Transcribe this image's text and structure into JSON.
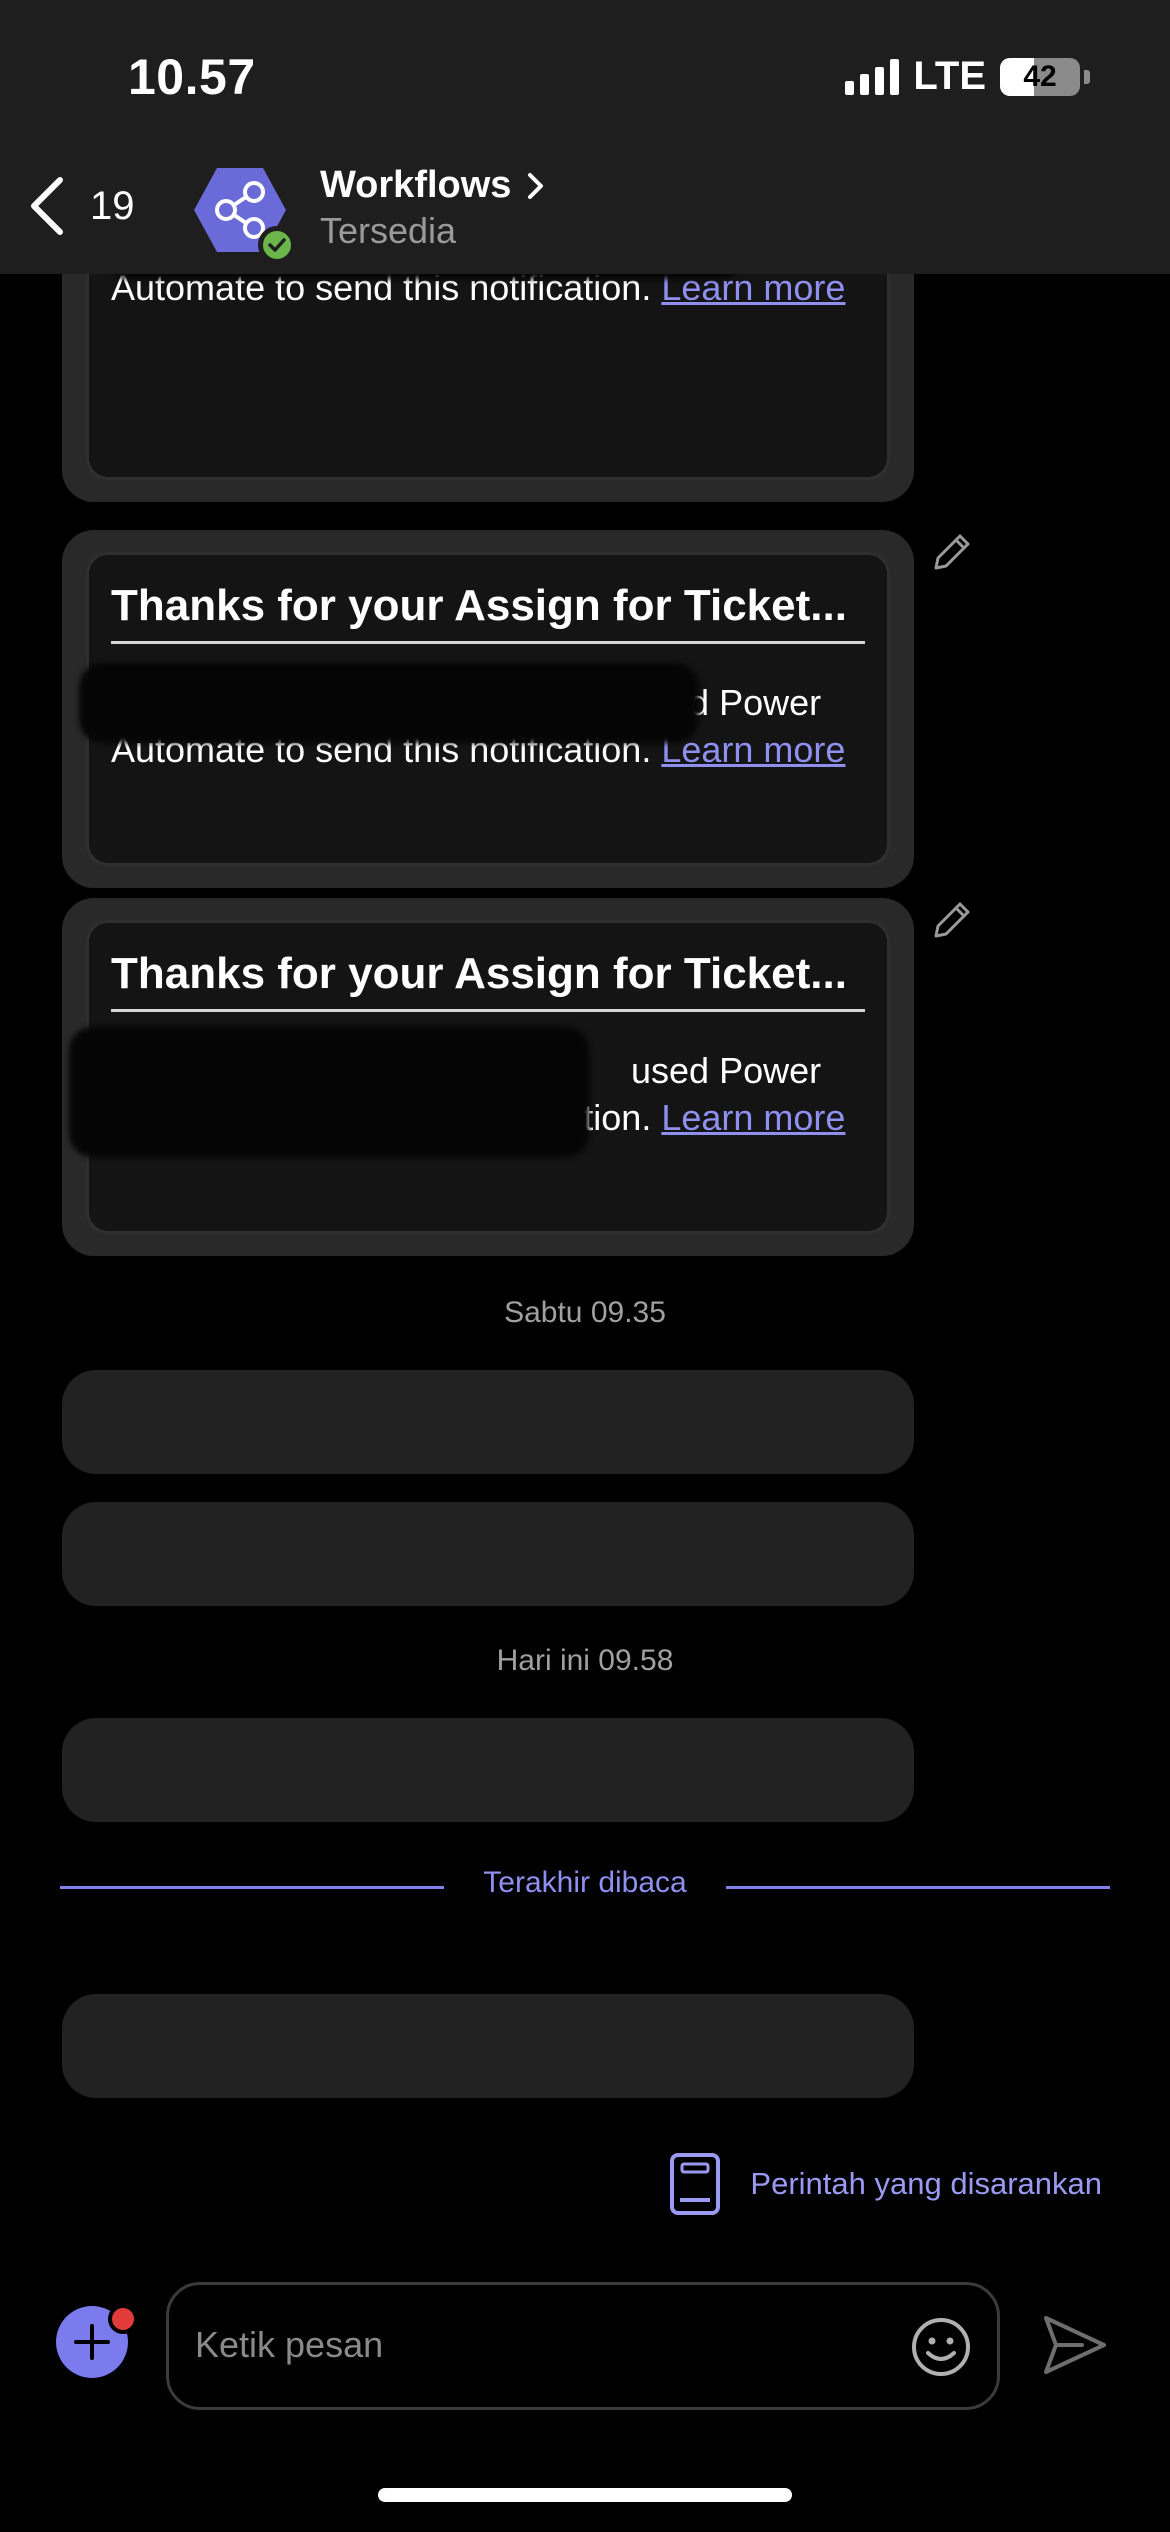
{
  "status": {
    "time": "10.57",
    "network": "LTE",
    "battery_percent": "42",
    "battery_level": 0.42
  },
  "header": {
    "back_count": "19",
    "title": "Workflows",
    "subtitle": "Tersedia",
    "accent": "#6a6ad8",
    "online_color": "#6bb54a"
  },
  "messages": [
    {
      "type": "card",
      "title": "",
      "body_text": "used Power Automate to send this notification.",
      "link_label": "Learn more"
    },
    {
      "type": "card",
      "title": "Thanks for your Assign for Ticket...",
      "body_text": "used Power Automate to send this notification.",
      "link_label": "Learn more"
    },
    {
      "type": "card",
      "title": "Thanks for your Assign for Ticket...",
      "body_text": "used Power Automate to send this notification.",
      "link_label": "Learn more"
    }
  ],
  "timestamps": {
    "saturday": "Sabtu 09.35",
    "today": "Hari ini 09.58"
  },
  "last_read_label": "Terakhir dibaca",
  "suggested_commands_label": "Perintah yang disarankan",
  "composer": {
    "placeholder": "Ketik pesan"
  },
  "icons": {
    "back": "chevron-left-icon",
    "title_chevron": "chevron-right-icon",
    "avatar": "share-hexagon-icon",
    "edit": "pencil-icon",
    "book": "book-icon",
    "add": "plus-icon",
    "emoji": "smiley-icon",
    "send": "send-icon"
  },
  "colors": {
    "link": "#8f8ff0",
    "divider": "#8080e8",
    "notification_dot": "#e33a3a"
  }
}
